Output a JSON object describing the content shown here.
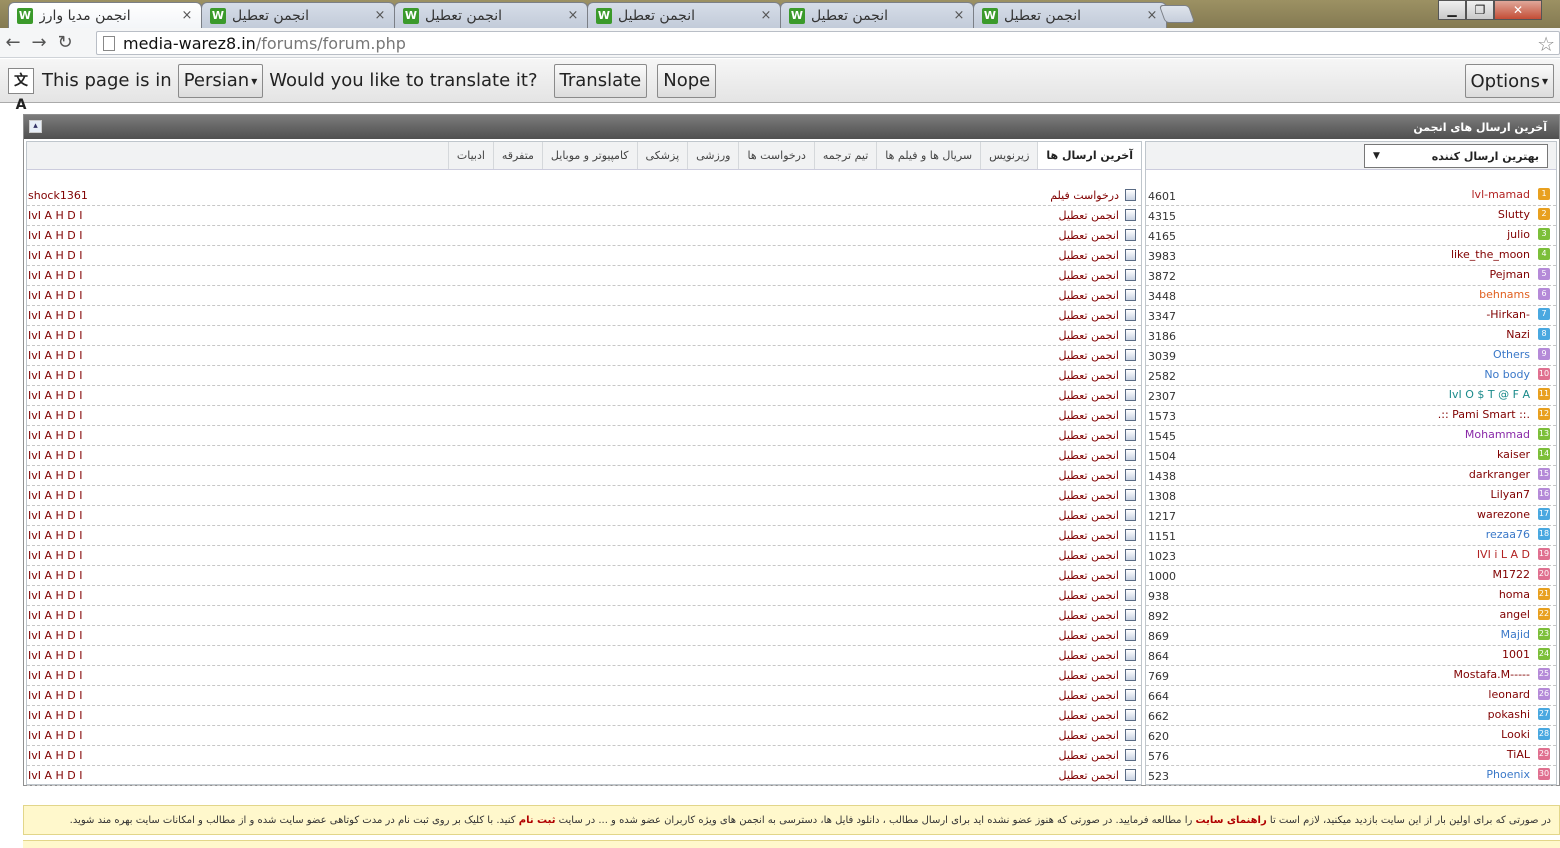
{
  "tabs": [
    {
      "title": "انجمن مدیا وارز",
      "active": true
    },
    {
      "title": "انجمن تعطیل",
      "active": false
    },
    {
      "title": "انجمن تعطیل",
      "active": false
    },
    {
      "title": "انجمن تعطیل",
      "active": false
    },
    {
      "title": "انجمن تعطیل",
      "active": false
    },
    {
      "title": "انجمن تعطیل",
      "active": false
    }
  ],
  "tab_close_glyph": "×",
  "favicon_letter": "W",
  "nav": {
    "back": "←",
    "forward": "→",
    "reload": "↻"
  },
  "url": {
    "host": "media-warez8.in",
    "path": "/forums/forum.php"
  },
  "translate": {
    "prefix": "This page is in",
    "language": "Persian",
    "question": "Would you like to translate it?",
    "translate_label": "Translate",
    "nope_label": "Nope",
    "options_label": "Options",
    "dropdown_glyph": "▾"
  },
  "panel": {
    "title": "آخرین ارسال های انجمن",
    "collapse_glyph": "▴"
  },
  "forum_tabs": [
    {
      "label": "آخرین ارسال ها",
      "active": true
    },
    {
      "label": "زیرنویس"
    },
    {
      "label": "سریال ها و فیلم ها"
    },
    {
      "label": "تیم ترجمه"
    },
    {
      "label": "درخواست ها"
    },
    {
      "label": "ورزشی"
    },
    {
      "label": "پزشکی"
    },
    {
      "label": "کامپیوتر و موبایل"
    },
    {
      "label": "متفرقه"
    },
    {
      "label": "ادبیات"
    }
  ],
  "posts": [
    {
      "title": "درخواست فیلم",
      "user": "shock1361"
    },
    {
      "title": "انجمن تعطیل",
      "user": "IvI A H D I"
    },
    {
      "title": "انجمن تعطیل",
      "user": "IvI A H D I"
    },
    {
      "title": "انجمن تعطیل",
      "user": "IvI A H D I"
    },
    {
      "title": "انجمن تعطیل",
      "user": "IvI A H D I"
    },
    {
      "title": "انجمن تعطیل",
      "user": "IvI A H D I"
    },
    {
      "title": "انجمن تعطیل",
      "user": "IvI A H D I"
    },
    {
      "title": "انجمن تعطیل",
      "user": "IvI A H D I"
    },
    {
      "title": "انجمن تعطیل",
      "user": "IvI A H D I"
    },
    {
      "title": "انجمن تعطیل",
      "user": "IvI A H D I"
    },
    {
      "title": "انجمن تعطیل",
      "user": "IvI A H D I"
    },
    {
      "title": "انجمن تعطیل",
      "user": "IvI A H D I"
    },
    {
      "title": "انجمن تعطیل",
      "user": "IvI A H D I"
    },
    {
      "title": "انجمن تعطیل",
      "user": "IvI A H D I"
    },
    {
      "title": "انجمن تعطیل",
      "user": "IvI A H D I"
    },
    {
      "title": "انجمن تعطیل",
      "user": "IvI A H D I"
    },
    {
      "title": "انجمن تعطیل",
      "user": "IvI A H D I"
    },
    {
      "title": "انجمن تعطیل",
      "user": "IvI A H D I"
    },
    {
      "title": "انجمن تعطیل",
      "user": "IvI A H D I"
    },
    {
      "title": "انجمن تعطیل",
      "user": "IvI A H D I"
    },
    {
      "title": "انجمن تعطیل",
      "user": "IvI A H D I"
    },
    {
      "title": "انجمن تعطیل",
      "user": "IvI A H D I"
    },
    {
      "title": "انجمن تعطیل",
      "user": "IvI A H D I"
    },
    {
      "title": "انجمن تعطیل",
      "user": "IvI A H D I"
    },
    {
      "title": "انجمن تعطیل",
      "user": "IvI A H D I"
    },
    {
      "title": "انجمن تعطیل",
      "user": "IvI A H D I"
    },
    {
      "title": "انجمن تعطیل",
      "user": "IvI A H D I"
    },
    {
      "title": "انجمن تعطیل",
      "user": "IvI A H D I"
    },
    {
      "title": "انجمن تعطیل",
      "user": "IvI A H D I"
    },
    {
      "title": "انجمن تعطیل",
      "user": "IvI A H D I"
    }
  ],
  "top_posters": {
    "selector_label": "بهترین ارسال کننده",
    "selector_glyph": "▼",
    "rows": [
      {
        "rank": "1",
        "name": "lvl-mamad",
        "count": "4601",
        "color": "#b22222",
        "badge": "#e8a020"
      },
      {
        "rank": "2",
        "name": "Slutty",
        "count": "4315",
        "color": "#800000",
        "badge": "#e8a020"
      },
      {
        "rank": "3",
        "name": "julio",
        "count": "4165",
        "color": "#800000",
        "badge": "#7cbf3a"
      },
      {
        "rank": "4",
        "name": "like_the_moon",
        "count": "3983",
        "color": "#800000",
        "badge": "#7cbf3a"
      },
      {
        "rank": "5",
        "name": "Pejman",
        "count": "3872",
        "color": "#800000",
        "badge": "#b58ad8"
      },
      {
        "rank": "6",
        "name": "behnams",
        "count": "3448",
        "color": "#e06020",
        "badge": "#b58ad8"
      },
      {
        "rank": "7",
        "name": "-Hirkan-",
        "count": "3347",
        "color": "#800000",
        "badge": "#4aa8e0"
      },
      {
        "rank": "8",
        "name": "Nazi",
        "count": "3186",
        "color": "#800000",
        "badge": "#4aa8e0"
      },
      {
        "rank": "9",
        "name": "Others",
        "count": "3039",
        "color": "#3a78c8",
        "badge": "#b58ad8"
      },
      {
        "rank": "10",
        "name": "No body",
        "count": "2582",
        "color": "#3a78c8",
        "badge": "#e07090"
      },
      {
        "rank": "11",
        "name": "IvI O $ T @ F A",
        "count": "2307",
        "color": "#1a8a8a",
        "badge": "#e8a020"
      },
      {
        "rank": "12",
        "name": ".:: Pami Smart ::.",
        "count": "1573",
        "color": "#800000",
        "badge": "#e8a020"
      },
      {
        "rank": "13",
        "name": "Mohammad",
        "count": "1545",
        "color": "#8a2aa8",
        "badge": "#7cbf3a"
      },
      {
        "rank": "14",
        "name": "kaiser",
        "count": "1504",
        "color": "#800000",
        "badge": "#7cbf3a"
      },
      {
        "rank": "15",
        "name": "darkranger",
        "count": "1438",
        "color": "#800000",
        "badge": "#b58ad8"
      },
      {
        "rank": "16",
        "name": "Lilyan7",
        "count": "1308",
        "color": "#800000",
        "badge": "#b58ad8"
      },
      {
        "rank": "17",
        "name": "warezone",
        "count": "1217",
        "color": "#800000",
        "badge": "#4aa8e0"
      },
      {
        "rank": "18",
        "name": "rezaa76",
        "count": "1151",
        "color": "#3a78c8",
        "badge": "#4aa8e0"
      },
      {
        "rank": "19",
        "name": "IVI i L A D",
        "count": "1023",
        "color": "#b22222",
        "badge": "#e07090"
      },
      {
        "rank": "20",
        "name": "M1722",
        "count": "1000",
        "color": "#800000",
        "badge": "#e07090"
      },
      {
        "rank": "21",
        "name": "homa",
        "count": "938",
        "color": "#800000",
        "badge": "#e8a020"
      },
      {
        "rank": "22",
        "name": "angel",
        "count": "892",
        "color": "#800000",
        "badge": "#e8a020"
      },
      {
        "rank": "23",
        "name": "Majid",
        "count": "869",
        "color": "#3a78c8",
        "badge": "#7cbf3a"
      },
      {
        "rank": "24",
        "name": "1001",
        "count": "864",
        "color": "#800000",
        "badge": "#7cbf3a"
      },
      {
        "rank": "25",
        "name": "Mostafa.M-----",
        "count": "769",
        "color": "#800000",
        "badge": "#b58ad8"
      },
      {
        "rank": "26",
        "name": "leonard",
        "count": "664",
        "color": "#800000",
        "badge": "#b58ad8"
      },
      {
        "rank": "27",
        "name": "pokashi",
        "count": "662",
        "color": "#800000",
        "badge": "#4aa8e0"
      },
      {
        "rank": "28",
        "name": "Looki",
        "count": "620",
        "color": "#800000",
        "badge": "#4aa8e0"
      },
      {
        "rank": "29",
        "name": "TiAL",
        "count": "576",
        "color": "#800000",
        "badge": "#e07090"
      },
      {
        "rank": "30",
        "name": "Phoenix",
        "count": "523",
        "color": "#3a78c8",
        "badge": "#e07090"
      }
    ]
  },
  "notice": {
    "part1": "در صورتی که برای اولین بار از این سایت بازدید میکنید، لازم است تا",
    "link1": "راهنمای سایت",
    "part2": "را مطالعه فرمایید. در صورتی که هنوز عضو نشده اید برای ارسال مطالب ، دانلود فایل ها، دسترسی به انجمن های ویژه کاربران عضو شده و ... در سایت",
    "link2": "ثبت نام",
    "part3": "کنید. با کلیک بر روی ثبت نام در مدت کوتاهی عضو سایت شده و از مطالب و امکانات سایت بهره مند شوید."
  }
}
